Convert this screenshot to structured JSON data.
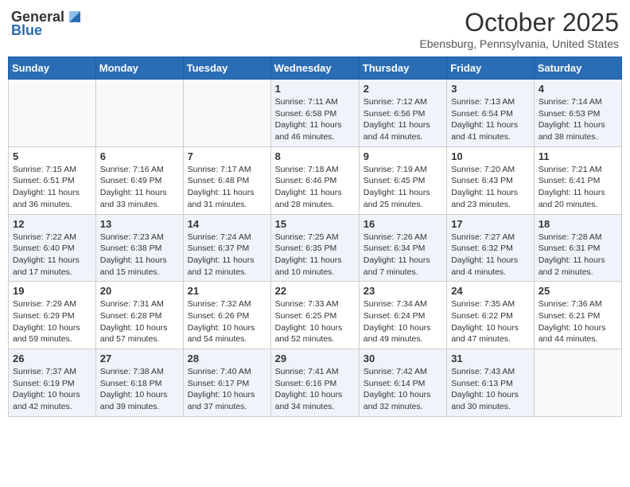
{
  "header": {
    "logo_general": "General",
    "logo_blue": "Blue",
    "month_title": "October 2025",
    "location": "Ebensburg, Pennsylvania, United States"
  },
  "calendar": {
    "days_of_week": [
      "Sunday",
      "Monday",
      "Tuesday",
      "Wednesday",
      "Thursday",
      "Friday",
      "Saturday"
    ],
    "weeks": [
      [
        {
          "day": "",
          "info": ""
        },
        {
          "day": "",
          "info": ""
        },
        {
          "day": "",
          "info": ""
        },
        {
          "day": "1",
          "info": "Sunrise: 7:11 AM\nSunset: 6:58 PM\nDaylight: 11 hours and 46 minutes."
        },
        {
          "day": "2",
          "info": "Sunrise: 7:12 AM\nSunset: 6:56 PM\nDaylight: 11 hours and 44 minutes."
        },
        {
          "day": "3",
          "info": "Sunrise: 7:13 AM\nSunset: 6:54 PM\nDaylight: 11 hours and 41 minutes."
        },
        {
          "day": "4",
          "info": "Sunrise: 7:14 AM\nSunset: 6:53 PM\nDaylight: 11 hours and 38 minutes."
        }
      ],
      [
        {
          "day": "5",
          "info": "Sunrise: 7:15 AM\nSunset: 6:51 PM\nDaylight: 11 hours and 36 minutes."
        },
        {
          "day": "6",
          "info": "Sunrise: 7:16 AM\nSunset: 6:49 PM\nDaylight: 11 hours and 33 minutes."
        },
        {
          "day": "7",
          "info": "Sunrise: 7:17 AM\nSunset: 6:48 PM\nDaylight: 11 hours and 31 minutes."
        },
        {
          "day": "8",
          "info": "Sunrise: 7:18 AM\nSunset: 6:46 PM\nDaylight: 11 hours and 28 minutes."
        },
        {
          "day": "9",
          "info": "Sunrise: 7:19 AM\nSunset: 6:45 PM\nDaylight: 11 hours and 25 minutes."
        },
        {
          "day": "10",
          "info": "Sunrise: 7:20 AM\nSunset: 6:43 PM\nDaylight: 11 hours and 23 minutes."
        },
        {
          "day": "11",
          "info": "Sunrise: 7:21 AM\nSunset: 6:41 PM\nDaylight: 11 hours and 20 minutes."
        }
      ],
      [
        {
          "day": "12",
          "info": "Sunrise: 7:22 AM\nSunset: 6:40 PM\nDaylight: 11 hours and 17 minutes."
        },
        {
          "day": "13",
          "info": "Sunrise: 7:23 AM\nSunset: 6:38 PM\nDaylight: 11 hours and 15 minutes."
        },
        {
          "day": "14",
          "info": "Sunrise: 7:24 AM\nSunset: 6:37 PM\nDaylight: 11 hours and 12 minutes."
        },
        {
          "day": "15",
          "info": "Sunrise: 7:25 AM\nSunset: 6:35 PM\nDaylight: 11 hours and 10 minutes."
        },
        {
          "day": "16",
          "info": "Sunrise: 7:26 AM\nSunset: 6:34 PM\nDaylight: 11 hours and 7 minutes."
        },
        {
          "day": "17",
          "info": "Sunrise: 7:27 AM\nSunset: 6:32 PM\nDaylight: 11 hours and 4 minutes."
        },
        {
          "day": "18",
          "info": "Sunrise: 7:28 AM\nSunset: 6:31 PM\nDaylight: 11 hours and 2 minutes."
        }
      ],
      [
        {
          "day": "19",
          "info": "Sunrise: 7:29 AM\nSunset: 6:29 PM\nDaylight: 10 hours and 59 minutes."
        },
        {
          "day": "20",
          "info": "Sunrise: 7:31 AM\nSunset: 6:28 PM\nDaylight: 10 hours and 57 minutes."
        },
        {
          "day": "21",
          "info": "Sunrise: 7:32 AM\nSunset: 6:26 PM\nDaylight: 10 hours and 54 minutes."
        },
        {
          "day": "22",
          "info": "Sunrise: 7:33 AM\nSunset: 6:25 PM\nDaylight: 10 hours and 52 minutes."
        },
        {
          "day": "23",
          "info": "Sunrise: 7:34 AM\nSunset: 6:24 PM\nDaylight: 10 hours and 49 minutes."
        },
        {
          "day": "24",
          "info": "Sunrise: 7:35 AM\nSunset: 6:22 PM\nDaylight: 10 hours and 47 minutes."
        },
        {
          "day": "25",
          "info": "Sunrise: 7:36 AM\nSunset: 6:21 PM\nDaylight: 10 hours and 44 minutes."
        }
      ],
      [
        {
          "day": "26",
          "info": "Sunrise: 7:37 AM\nSunset: 6:19 PM\nDaylight: 10 hours and 42 minutes."
        },
        {
          "day": "27",
          "info": "Sunrise: 7:38 AM\nSunset: 6:18 PM\nDaylight: 10 hours and 39 minutes."
        },
        {
          "day": "28",
          "info": "Sunrise: 7:40 AM\nSunset: 6:17 PM\nDaylight: 10 hours and 37 minutes."
        },
        {
          "day": "29",
          "info": "Sunrise: 7:41 AM\nSunset: 6:16 PM\nDaylight: 10 hours and 34 minutes."
        },
        {
          "day": "30",
          "info": "Sunrise: 7:42 AM\nSunset: 6:14 PM\nDaylight: 10 hours and 32 minutes."
        },
        {
          "day": "31",
          "info": "Sunrise: 7:43 AM\nSunset: 6:13 PM\nDaylight: 10 hours and 30 minutes."
        },
        {
          "day": "",
          "info": ""
        }
      ]
    ]
  }
}
